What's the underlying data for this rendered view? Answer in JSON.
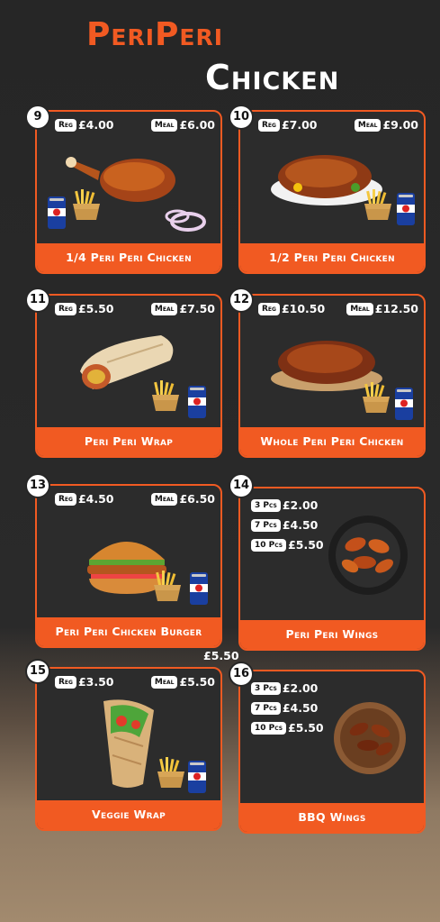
{
  "title": {
    "line1": "PeriPeri",
    "line2": "Chicken"
  },
  "items": [
    {
      "number": "9",
      "reg_label": "Reg",
      "reg": "£4.00",
      "meal_label": "Meal",
      "meal": "£6.00",
      "name": "1/4 Peri Peri Chicken"
    },
    {
      "number": "10",
      "reg_label": "Reg",
      "reg": "£7.00",
      "meal_label": "Meal",
      "meal": "£9.00",
      "name": "1/2 Peri Peri Chicken"
    },
    {
      "number": "11",
      "reg_label": "Reg",
      "reg": "£5.50",
      "meal_label": "Meal",
      "meal": "£7.50",
      "name": "Peri Peri Wrap"
    },
    {
      "number": "12",
      "reg_label": "Reg",
      "reg": "£10.50",
      "meal_label": "Meal",
      "meal": "£12.50",
      "name": "Whole Peri Peri Chicken"
    },
    {
      "number": "13",
      "reg_label": "Reg",
      "reg": "£4.50",
      "meal_label": "Meal",
      "meal": "£6.50",
      "name": "Peri Peri Chicken Burger"
    },
    {
      "number": "14",
      "name": "Peri Peri Wings",
      "pcs": [
        {
          "label": "3 Pcs",
          "price": "£2.00"
        },
        {
          "label": "7 Pcs",
          "price": "£4.50"
        },
        {
          "label": "10 Pcs",
          "price": "£5.50"
        }
      ]
    },
    {
      "number": "15",
      "reg_label": "Reg",
      "reg": "£3.50",
      "meal_label": "Meal",
      "meal": "£5.50",
      "name": "Veggie Wrap"
    },
    {
      "number": "16",
      "name": "BBQ Wings",
      "pcs": [
        {
          "label": "3 Pcs",
          "price": "£2.00"
        },
        {
          "label": "7 Pcs",
          "price": "£4.50"
        },
        {
          "label": "10 Pcs",
          "price": "£5.50"
        }
      ]
    }
  ],
  "stray_price": "£5.50",
  "can_brand": "PEPSI",
  "colors": {
    "accent": "#f15a22",
    "background": "#262626"
  }
}
